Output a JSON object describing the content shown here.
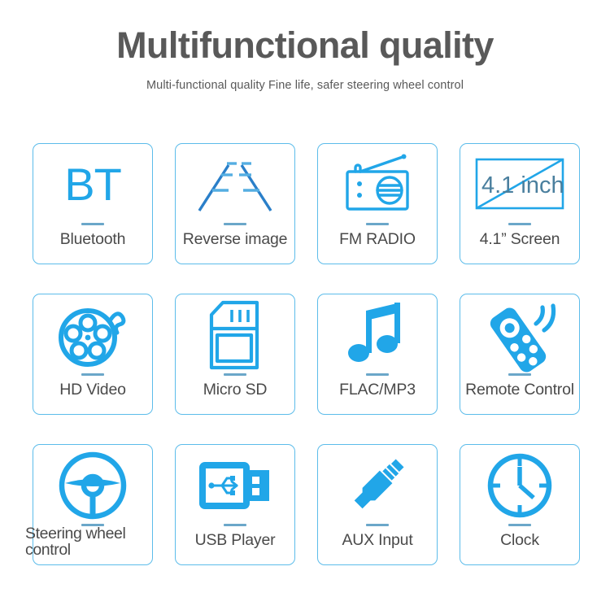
{
  "header": {
    "title": "Multifunctional quality",
    "subtitle": "Multi-functional quality Fine life, safer steering wheel control"
  },
  "theme": {
    "accent_blue": "#21a6e8",
    "card_border": "#5cbcea",
    "divider": "#6ba7c9",
    "label_text": "#4a4a4a",
    "title_text": "#595959",
    "background": "#ffffff"
  },
  "features": [
    {
      "label": "Bluetooth",
      "icon": "bluetooth-bt-icon",
      "icon_text": "BT"
    },
    {
      "label": "Reverse image",
      "icon": "reverse-camera-guideline-icon"
    },
    {
      "label": "FM RADIO",
      "icon": "radio-icon"
    },
    {
      "label": "4.1”  Screen",
      "icon": "screen-icon",
      "icon_text": "4.1 inch"
    },
    {
      "label": "HD Video",
      "icon": "film-reel-icon"
    },
    {
      "label": "Micro SD",
      "icon": "sd-card-icon"
    },
    {
      "label": "FLAC/MP3",
      "icon": "music-note-icon"
    },
    {
      "label": "Remote Control",
      "icon": "remote-control-icon"
    },
    {
      "label": "Steering wheel control",
      "icon": "steering-wheel-icon"
    },
    {
      "label": "USB Player",
      "icon": "usb-drive-icon"
    },
    {
      "label": "AUX Input",
      "icon": "aux-jack-icon"
    },
    {
      "label": "Clock",
      "icon": "clock-icon"
    }
  ]
}
